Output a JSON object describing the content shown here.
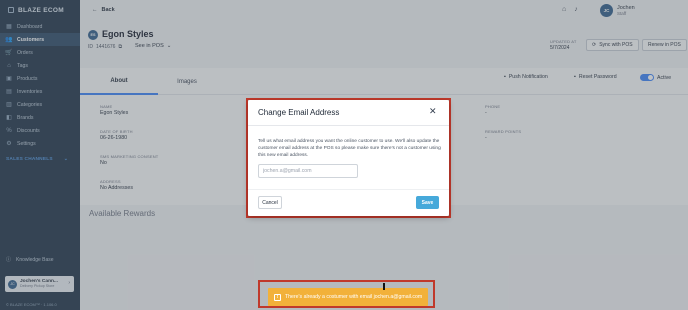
{
  "sidebar": {
    "brand": "BLAZE ECOM",
    "items": [
      {
        "label": "Dashboard",
        "icon": "dashboard-icon",
        "glyph": "▦"
      },
      {
        "label": "Customers",
        "icon": "users-icon",
        "glyph": "👥"
      },
      {
        "label": "Orders",
        "icon": "cart-icon",
        "glyph": "🛒"
      },
      {
        "label": "Tags",
        "icon": "tag-icon",
        "glyph": "⌂"
      },
      {
        "label": "Products",
        "icon": "box-icon",
        "glyph": "▣"
      },
      {
        "label": "Inventories",
        "icon": "inventory-icon",
        "glyph": "▤"
      },
      {
        "label": "Categories",
        "icon": "categories-icon",
        "glyph": "▥"
      },
      {
        "label": "Brands",
        "icon": "brand-icon",
        "glyph": "◧"
      },
      {
        "label": "Discounts",
        "icon": "discount-icon",
        "glyph": "%"
      },
      {
        "label": "Settings",
        "icon": "gear-icon",
        "glyph": "⚙"
      }
    ],
    "active_item": "Customers",
    "sales_channels": "SALES CHANNELS",
    "knowledge_base": "Knowledge Base",
    "shop": {
      "initials": "JC",
      "name": "Jochen's Cann...",
      "sub": "Delivery Pickup Store"
    },
    "version": "© BLAZE ECOM™ · 1.106.0"
  },
  "topbar": {
    "back_label": "Back",
    "user": {
      "initials": "JC",
      "name": "Jochen",
      "role": "Staff"
    }
  },
  "customer": {
    "initials": "ES",
    "name": "Egon Styles",
    "id": "1441676",
    "see_in_pos": "See in POS",
    "updated_label": "UPDATED AT",
    "updated_value": "5/7/2024",
    "sync_button": "Sync with POS",
    "renew_button": "Renew in POS"
  },
  "tabs": {
    "about": "About",
    "images": "Images",
    "push_notification": "Push Notification",
    "reset_password": "Reset Password",
    "active_label": "Active"
  },
  "about": {
    "name_label": "NAME",
    "name_value": "Egon Styles",
    "dob_label": "DATE OF BIRTH",
    "dob_value": "06-26-1980",
    "sms_label": "SMS MARKETING CONSENT",
    "sms_value": "No",
    "address_label": "ADDRESS",
    "address_value": "No Addresses",
    "phone_label": "PHONE",
    "phone_value": "-",
    "reward_label": "REWARD POINTS",
    "reward_value": "-"
  },
  "rewards_title": "Available Rewards",
  "modal": {
    "title": "Change Email Address",
    "body": "Tell us what email address you want the online customer to use. We'll also update the customer email address at the POS so please make sure there's not a customer using this new email address.",
    "input_placeholder": "jochen.a@gmail.com",
    "cancel": "Cancel",
    "save": "Save"
  },
  "toast": {
    "message": "There's already a costumer with email jochen.a@gmail.com",
    "color": "#f2b13a"
  },
  "colors": {
    "sidebar_bg": "#1f3347",
    "accent": "#3b82f6",
    "save_button": "#46a9da",
    "highlight_outline": "#c0392b"
  }
}
